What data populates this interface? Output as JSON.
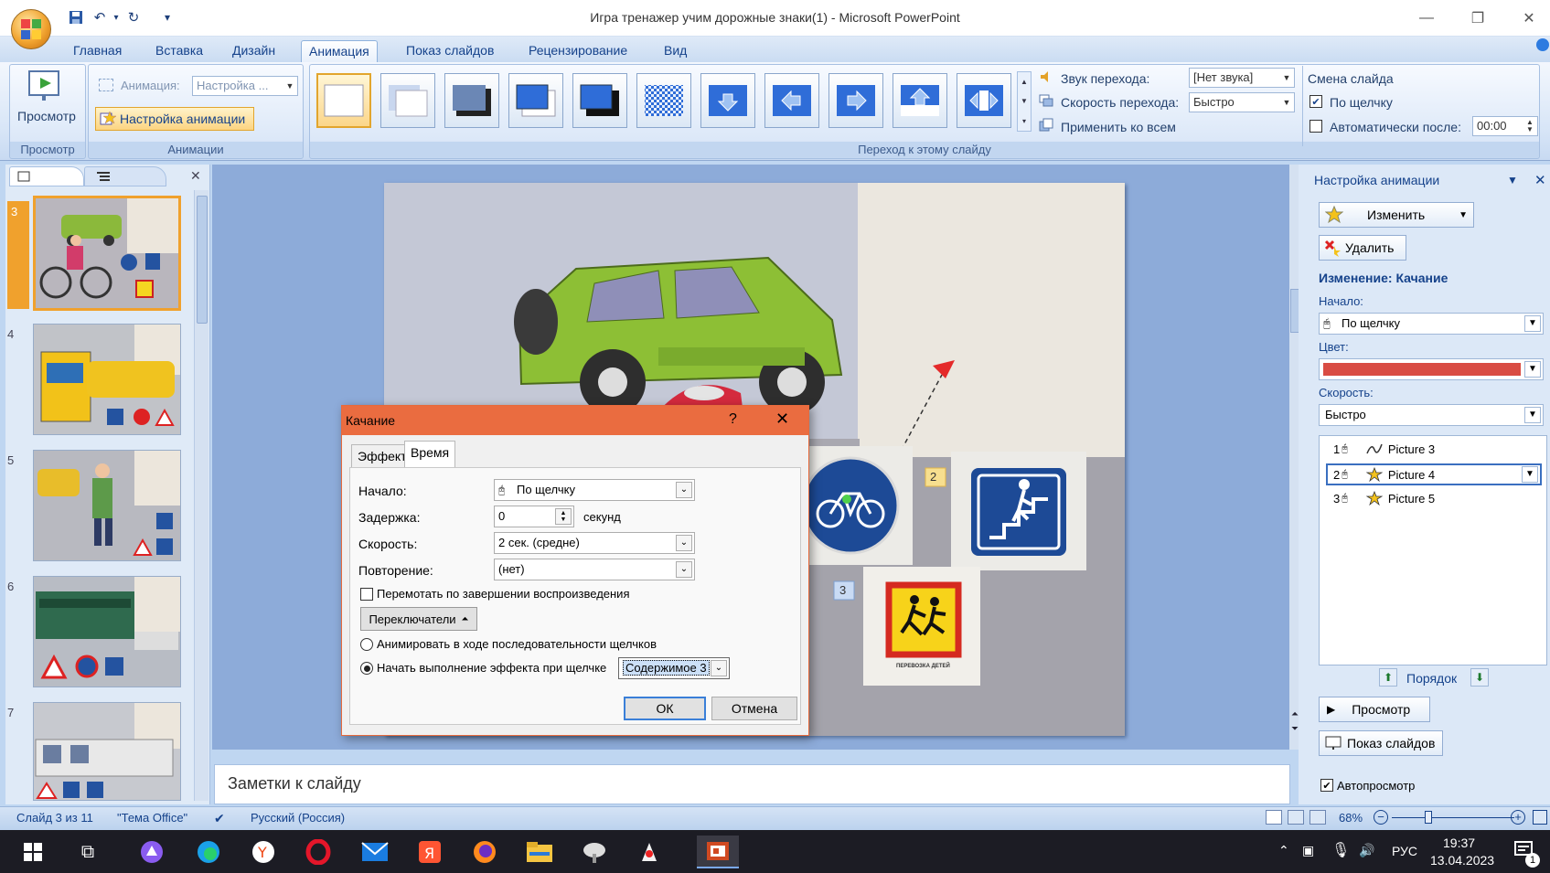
{
  "window": {
    "title": "Игра тренажер учим дорожные знаки(1) - Microsoft PowerPoint",
    "controls": [
      "minimize",
      "restore",
      "close"
    ]
  },
  "quick_access": [
    "save-icon",
    "undo-icon",
    "redo-icon",
    "customize-icon"
  ],
  "tabs": [
    {
      "label": "Главная",
      "active": false
    },
    {
      "label": "Вставка",
      "active": false
    },
    {
      "label": "Дизайн",
      "active": false
    },
    {
      "label": "Анимация",
      "active": true
    },
    {
      "label": "Показ слайдов",
      "active": false
    },
    {
      "label": "Рецензирование",
      "active": false
    },
    {
      "label": "Вид",
      "active": false
    }
  ],
  "ribbon": {
    "preview_group": {
      "button": "Просмотр",
      "label": "Просмотр"
    },
    "animations_group": {
      "label": "Анимации",
      "animation_label": "Анимация:",
      "animation_value": "Настройка ...",
      "custom_button": "Настройка анимации"
    },
    "transition_group": {
      "label": "Переход к этому слайду",
      "sound_label": "Звук перехода:",
      "sound_value": "[Нет звука]",
      "speed_label": "Скорость перехода:",
      "speed_value": "Быстро",
      "apply_all": "Применить ко всем"
    },
    "advance_group": {
      "title": "Смена слайда",
      "on_click": "По щелчку",
      "on_click_checked": true,
      "auto_after": "Автоматически после:",
      "auto_after_checked": false,
      "auto_time": "00:00"
    }
  },
  "slides_panel": {
    "thumbnails": [
      {
        "number": "3",
        "selected": true
      },
      {
        "number": "4",
        "selected": false
      },
      {
        "number": "5",
        "selected": false
      },
      {
        "number": "6",
        "selected": false
      },
      {
        "number": "7",
        "selected": false
      }
    ]
  },
  "slide": {
    "markers": [
      "2",
      "3"
    ],
    "sign_caption": "ПЕРЕВОЗКА ДЕТЕЙ"
  },
  "notes": {
    "placeholder": "Заметки к слайду"
  },
  "dialog": {
    "title": "Качание",
    "help": "?",
    "tabs": [
      {
        "label": "Эффект",
        "active": false
      },
      {
        "label": "Время",
        "active": true
      }
    ],
    "start_label": "Начало:",
    "start_value": "По щелчку",
    "delay_label": "Задержка:",
    "delay_value": "0",
    "delay_unit": "секунд",
    "speed_label": "Скорость:",
    "speed_value": "2 сек. (средне)",
    "repeat_label": "Повторение:",
    "repeat_value": "(нет)",
    "rewind_label": "Перемотать по завершении воспроизведения",
    "rewind_checked": false,
    "triggers_button": "Переключатели",
    "animate_sequence": "Анимировать в ходе последовательности щелчков",
    "start_on_click": "Начать выполнение эффекта при щелчке",
    "trigger_selected": "start_on_click",
    "trigger_target": "Содержимое 3",
    "ok": "ОК",
    "cancel": "Отмена"
  },
  "task_pane": {
    "title": "Настройка анимации",
    "change_button": "Изменить",
    "delete_button": "Удалить",
    "modify_title": "Изменение: Качание",
    "start_label": "Начало:",
    "start_value": "По щелчку",
    "color_label": "Цвет:",
    "color_value": "#d94c43",
    "speed_label": "Скорость:",
    "speed_value": "Быстро",
    "items": [
      {
        "index": "1",
        "name": "Picture 3",
        "selected": false
      },
      {
        "index": "2",
        "name": "Picture 4",
        "selected": true
      },
      {
        "index": "3",
        "name": "Picture 5",
        "selected": false
      }
    ],
    "order_label": "Порядок",
    "preview_button": "Просмотр",
    "slideshow_button": "Показ слайдов",
    "autopreview_label": "Автопросмотр",
    "autopreview_checked": true
  },
  "status_bar": {
    "slide_info": "Слайд 3 из 11",
    "theme": "\"Тема Office\"",
    "language": "Русский (Россия)",
    "zoom": "68%"
  },
  "taskbar": {
    "lang": "РУС",
    "time": "19:37",
    "date": "13.04.2023",
    "notifications": "1"
  }
}
